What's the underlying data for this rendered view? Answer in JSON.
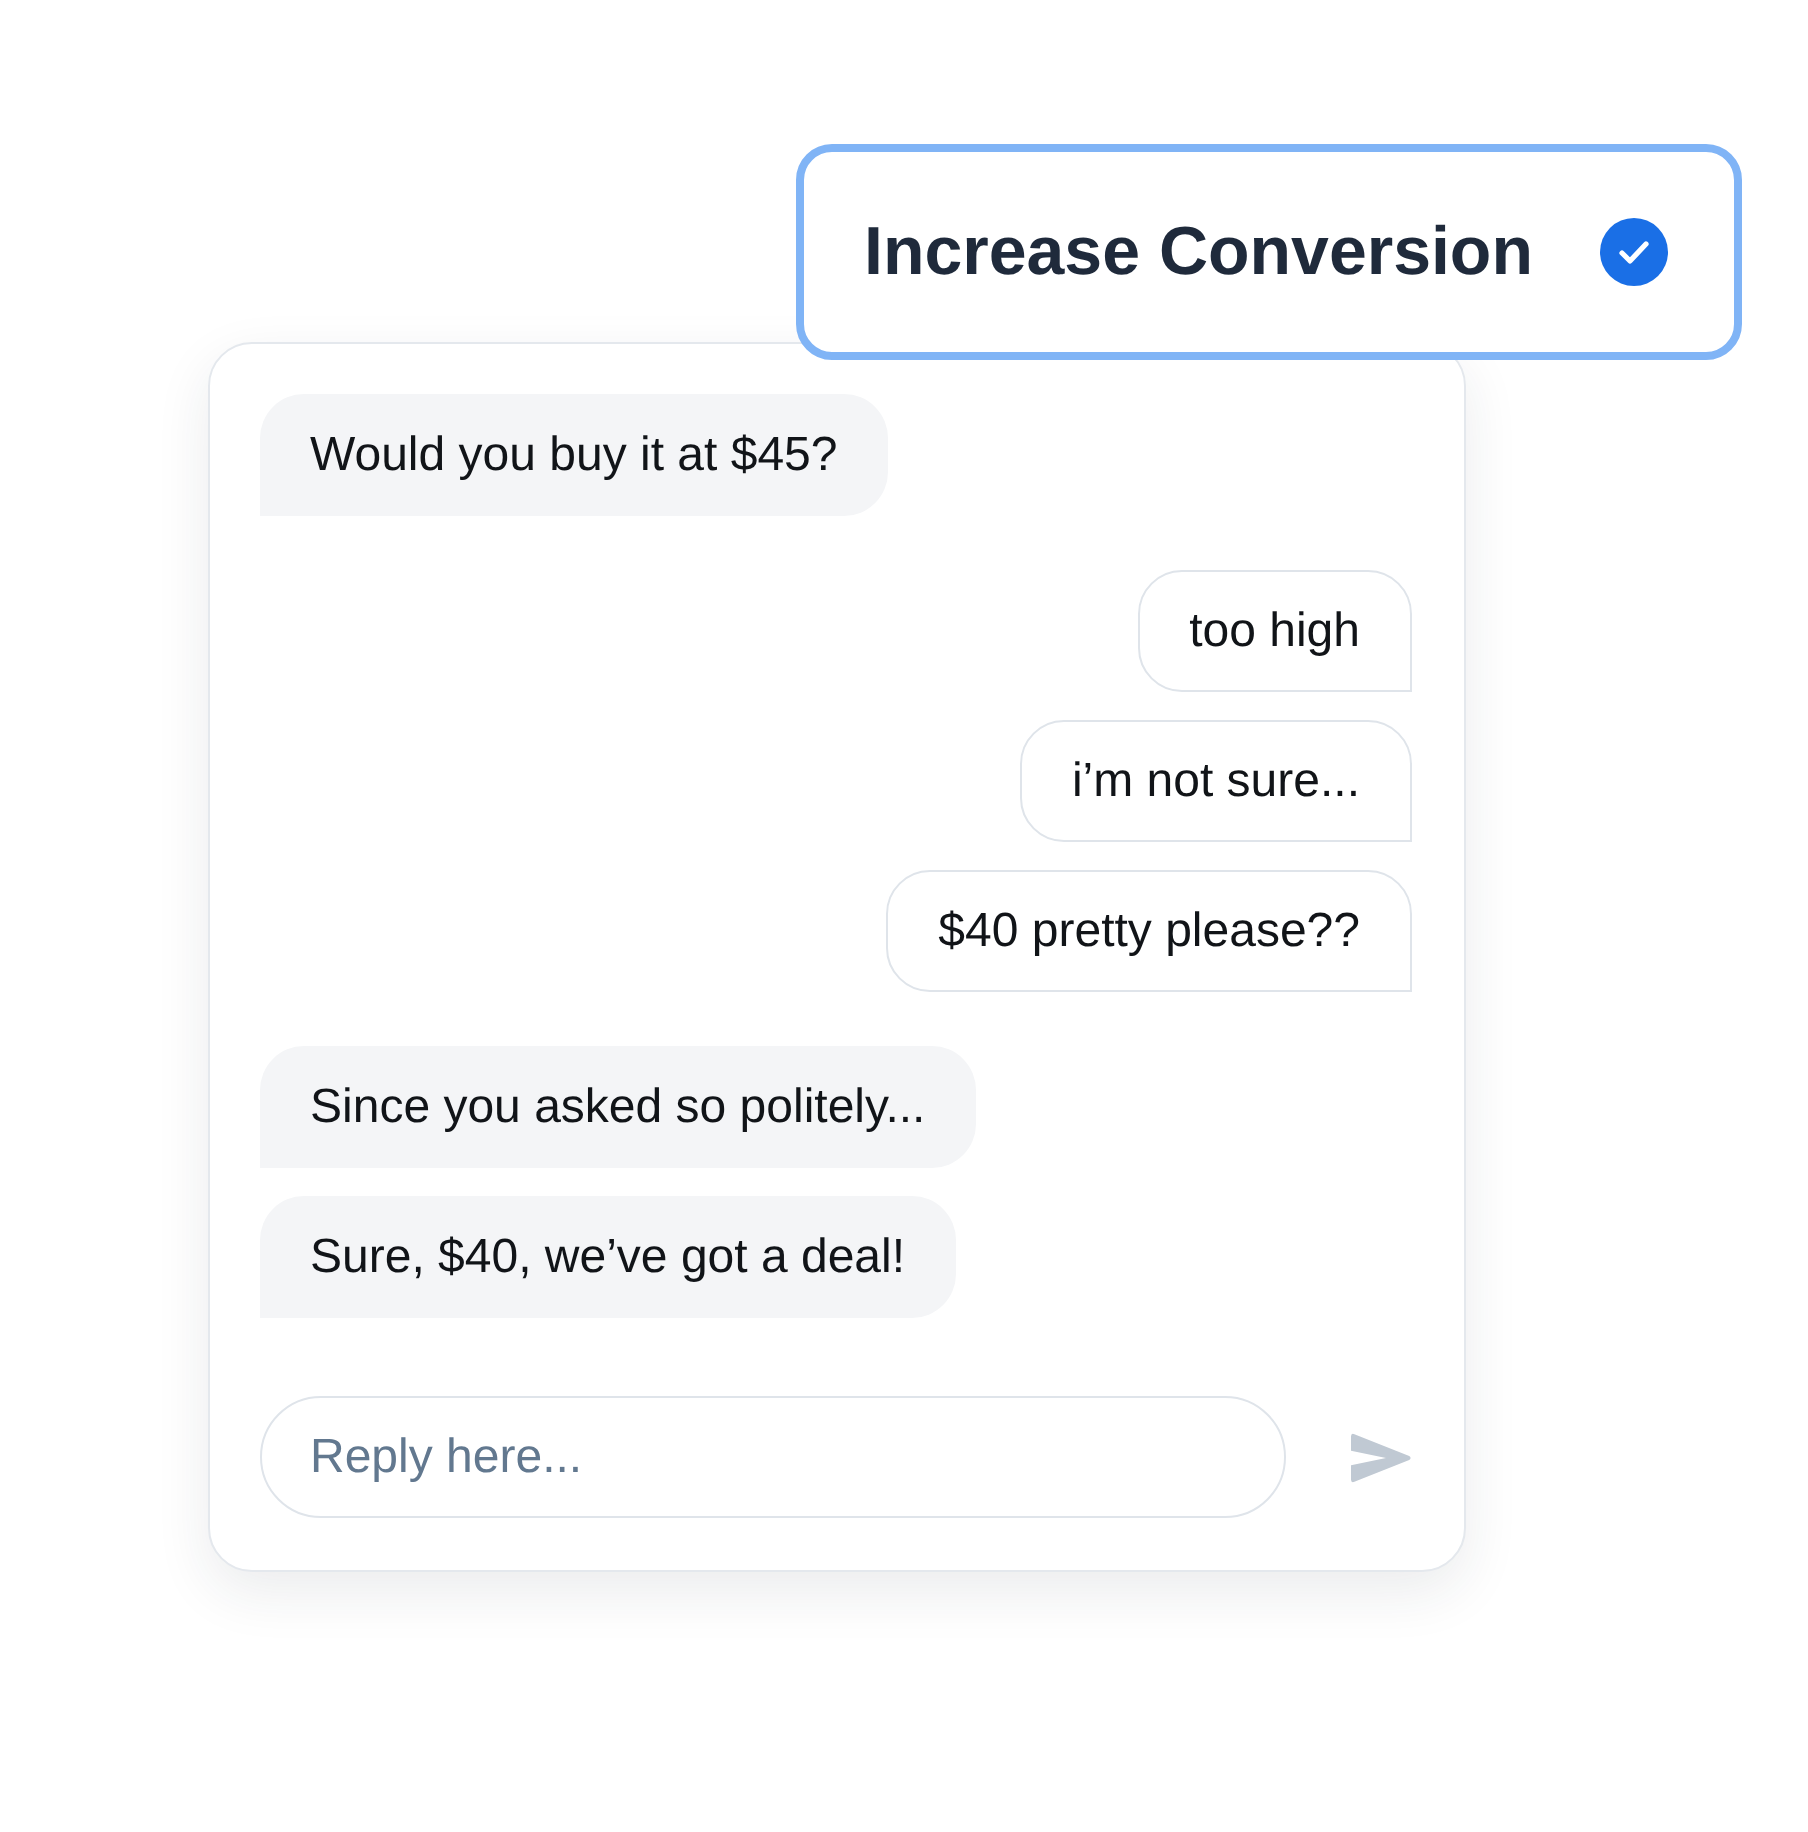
{
  "badge": {
    "label": "Increase Conversion",
    "checked": true
  },
  "messages": [
    {
      "kind": "received",
      "text": "Would you buy it at $45?"
    },
    {
      "kind": "sent",
      "text": "too high"
    },
    {
      "kind": "sent",
      "text": "i’m not sure..."
    },
    {
      "kind": "sent",
      "text": "$40 pretty please??"
    },
    {
      "kind": "received",
      "text": "Since you asked so politely..."
    },
    {
      "kind": "received",
      "text": "Sure, $40, we’ve got a deal!"
    }
  ],
  "reply": {
    "placeholder": "Reply here..."
  }
}
